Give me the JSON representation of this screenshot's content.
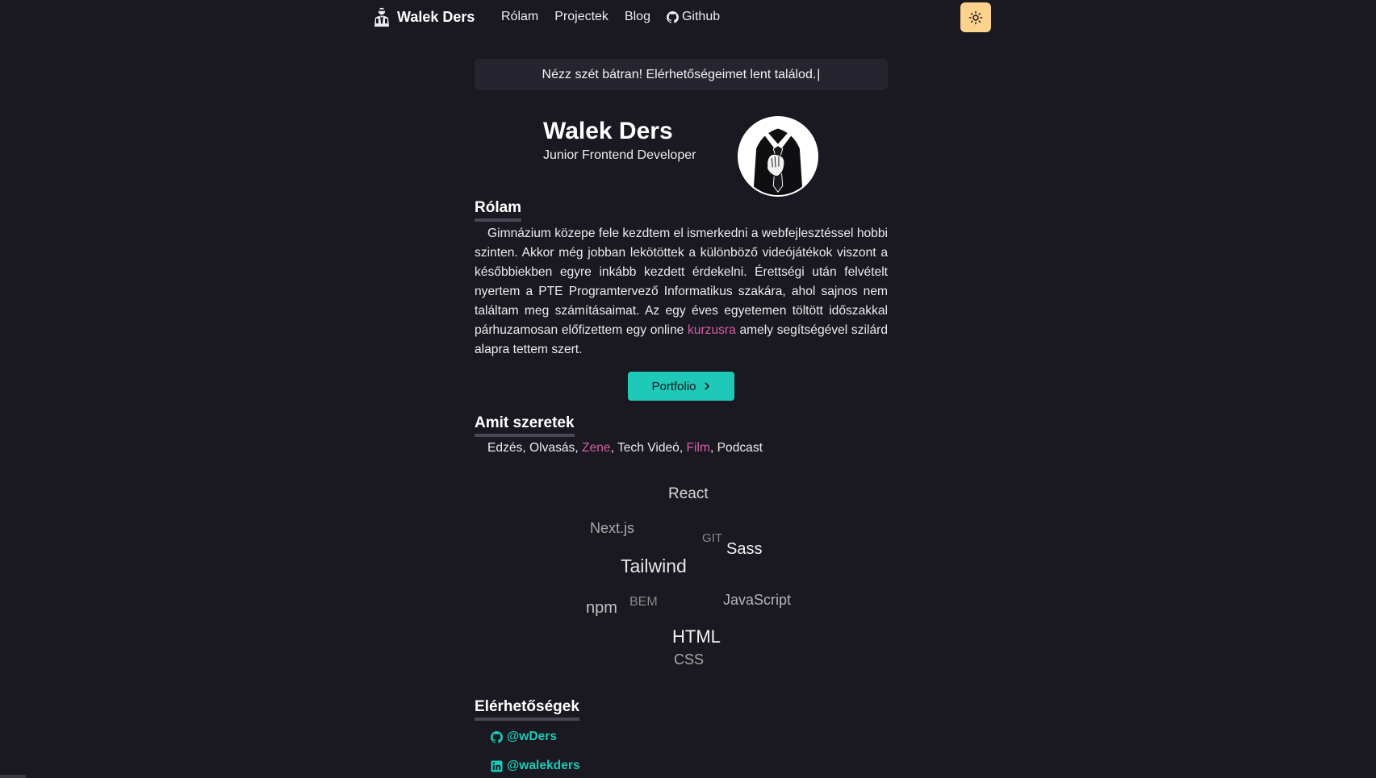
{
  "nav": {
    "brand": "Walek Ders",
    "links": [
      {
        "label": "Rólam"
      },
      {
        "label": "Projectek"
      },
      {
        "label": "Blog"
      },
      {
        "label": "Github",
        "icon": "github-icon"
      }
    ],
    "theme_toggle_icon": "sun-icon"
  },
  "greeting": {
    "text": "Nézz szét bátran! Elérhetőségeimet lent találod.",
    "cursor": "|"
  },
  "profile": {
    "name": "Walek Ders",
    "role": "Junior Frontend Developer"
  },
  "about": {
    "title": "Rólam",
    "text_before_link": "Gimnázium közepe fele kezdtem el ismerkedni a webfejlesztéssel hobbi szinten. Akkor még jobban lekötöttek a különböző videójátékok viszont a későbbiekben egyre inkább kezdett érdekelni. Érettségi után felvételt nyertem a PTE Programtervező Informatikus szakára, ahol sajnos nem találtam meg számításaimat. Az egy éves egyetemen töltött időszakkal párhuzamosan előfizettem egy online ",
    "link": "kurzusra",
    "text_after_link": " amely segítségével szilárd alapra tettem szert."
  },
  "portfolio_button": {
    "label": "Portfolio",
    "icon": "chevron-right-icon"
  },
  "likes": {
    "title": "Amit szeretek",
    "items": [
      {
        "label": "Edzés",
        "highlight": false
      },
      {
        "label": "Olvasás",
        "highlight": false
      },
      {
        "label": "Zene",
        "highlight": true
      },
      {
        "label": "Tech Videó",
        "highlight": false
      },
      {
        "label": "Film",
        "highlight": true
      },
      {
        "label": "Podcast",
        "highlight": false
      }
    ]
  },
  "skills": [
    "React",
    "Next.js",
    "GIT",
    "Sass",
    "Tailwind",
    "npm",
    "BEM",
    "JavaScript",
    "HTML",
    "CSS"
  ],
  "contacts": {
    "title": "Elérhetőségek",
    "items": [
      {
        "label": "@wDers",
        "icon": "github-icon"
      },
      {
        "label": "@walekders",
        "icon": "linkedin-icon"
      }
    ]
  },
  "colors": {
    "background": "#1a1820",
    "accent": "#1fc9b7",
    "link_pink": "#d55fa5",
    "theme_button": "#fbd38d"
  }
}
